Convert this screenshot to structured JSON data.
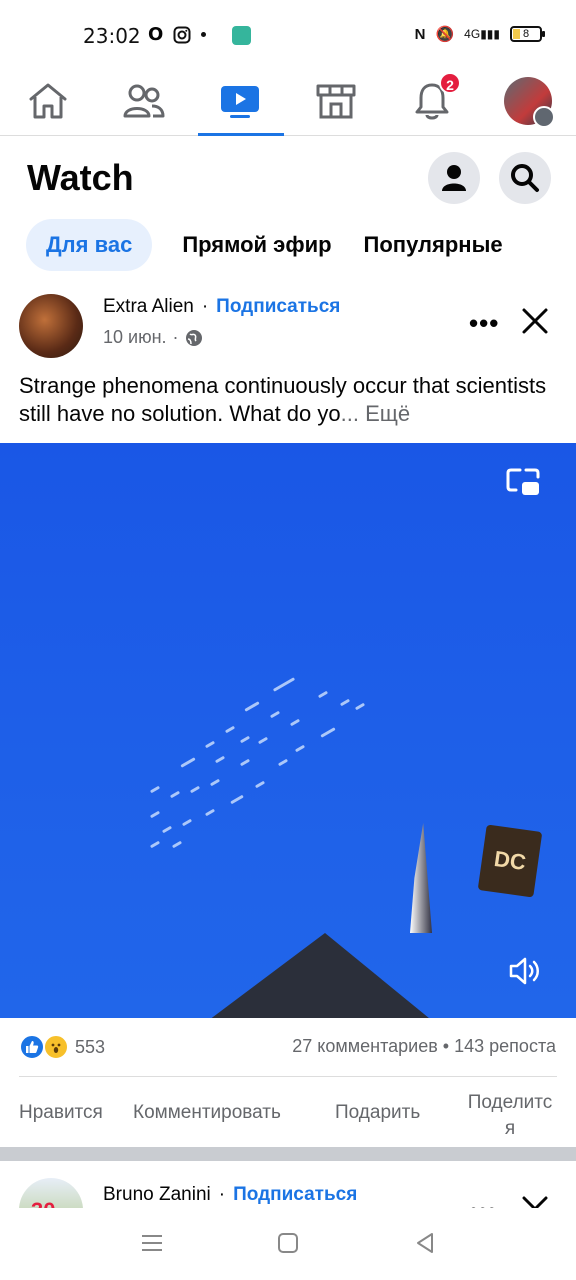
{
  "status_bar": {
    "time": "23:02",
    "battery_level": "8",
    "network": "4G"
  },
  "top_nav": {
    "items": [
      {
        "name": "home",
        "icon": "home-icon"
      },
      {
        "name": "friends",
        "icon": "friends-icon"
      },
      {
        "name": "watch",
        "icon": "video-icon",
        "active": true
      },
      {
        "name": "marketplace",
        "icon": "store-icon"
      },
      {
        "name": "notifications",
        "icon": "bell-icon",
        "badge": "2"
      },
      {
        "name": "menu",
        "icon": "avatar-menu-icon"
      }
    ]
  },
  "header": {
    "title": "Watch"
  },
  "tabs": [
    {
      "label": "Для вас",
      "active": true
    },
    {
      "label": "Прямой эфир"
    },
    {
      "label": "Популярные"
    }
  ],
  "post": {
    "author": "Extra Alien",
    "separator": "·",
    "subscribe": "Подписаться",
    "date": "10 июн.",
    "meta_separator": "·",
    "text": "Strange phenomena continuously occur that scientists still have no solution. What do yo",
    "ellipsis": "...",
    "more_label": "Ещё",
    "video_logo": "DC",
    "reactions_count": "553",
    "comments": "27 комментариев",
    "counts_separator": "•",
    "shares": "143 репоста",
    "actions": {
      "like": "Нравится",
      "comment": "Комментировать",
      "gift": "Подарить",
      "share_line1": "Поделитс",
      "share_line2": "я"
    }
  },
  "next_post": {
    "author": "Bruno Zanini",
    "separator": "·",
    "subscribe": "Подписаться",
    "avatar_text": "30"
  },
  "colors": {
    "accent": "#1b74e4",
    "badge": "#e41e3f",
    "video_bg": "#1e5fe8",
    "muted_text": "#65676b"
  }
}
